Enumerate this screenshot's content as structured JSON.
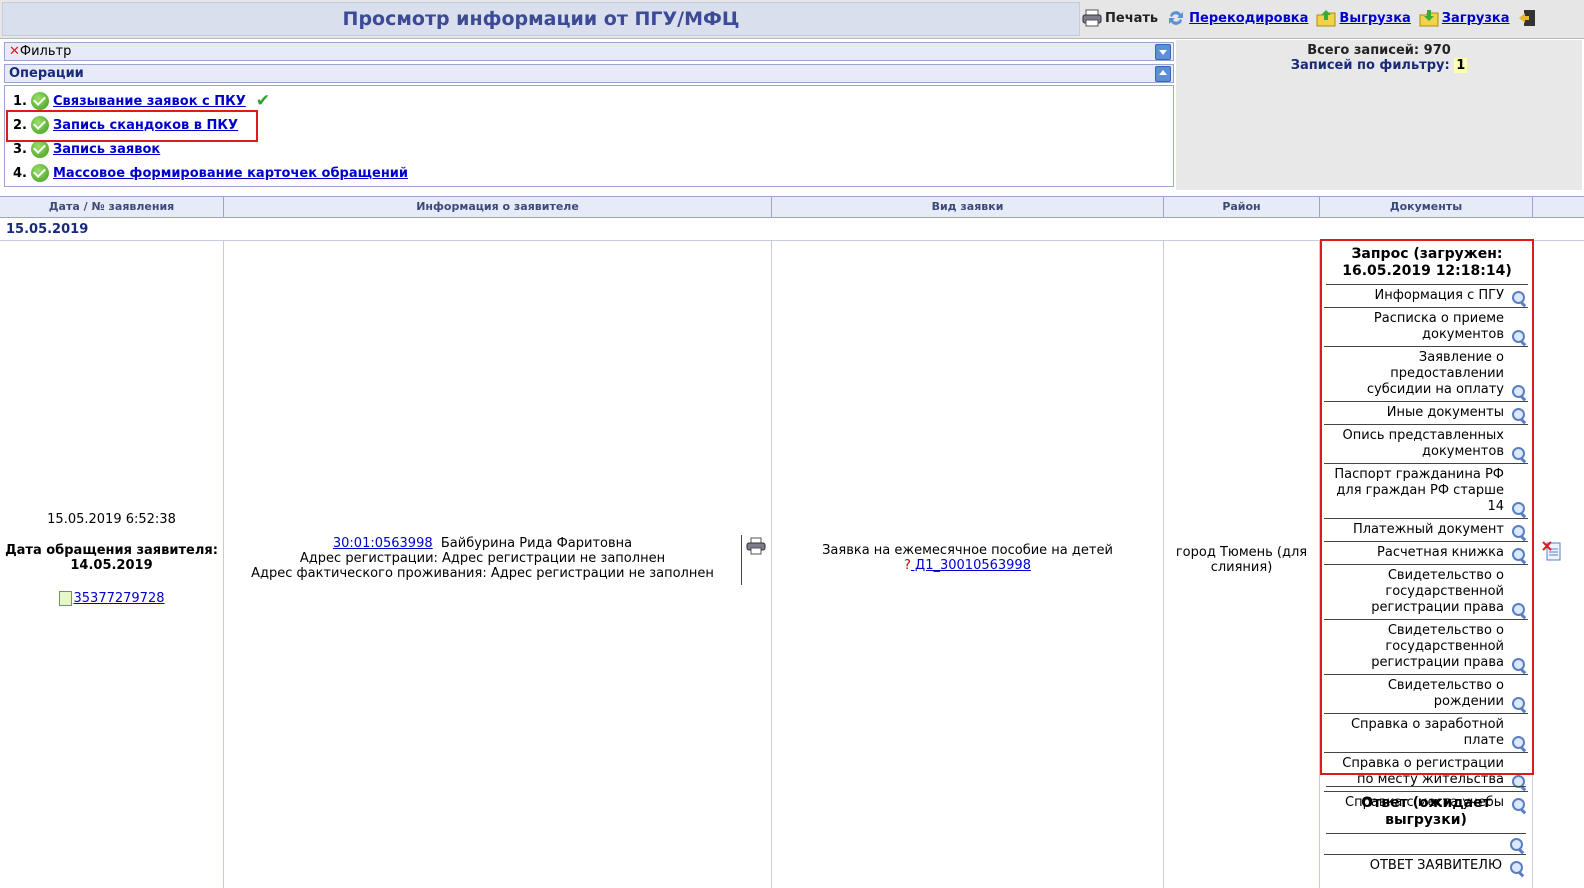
{
  "header": {
    "title": "Просмотр информации от ПГУ/МФЦ",
    "tools": [
      {
        "label": "Печать",
        "icon": "printer-icon"
      },
      {
        "label": "Перекодировка",
        "icon": "recode-icon"
      },
      {
        "label": "Выгрузка",
        "icon": "export-icon"
      },
      {
        "label": "Загрузка",
        "icon": "import-icon"
      }
    ]
  },
  "filter": {
    "label": "Фильтр"
  },
  "operations": {
    "title": "Операции",
    "items": [
      {
        "num": "1.",
        "label": "Связывание заявок с ПКУ"
      },
      {
        "num": "2.",
        "label": "Запись скандоков в ПКУ"
      },
      {
        "num": "3.",
        "label": "Запись заявок"
      },
      {
        "num": "4.",
        "label": "Массовое формирование карточек обращений"
      }
    ]
  },
  "stats": {
    "total_label": "Всего записей:",
    "total": "970",
    "filter_label": "Записей по фильтру:",
    "filter_count": "1"
  },
  "table": {
    "columns": [
      "Дата / № заявления",
      "Информация о заявителе",
      "Вид заявки",
      "Район",
      "Документы"
    ],
    "date_group": "15.05.2019",
    "row": {
      "datetime": "15.05.2019 6:52:38",
      "applied_label": "Дата обращения заявителя: 14.05.2019",
      "doc_number": "35377279728",
      "applicant_id": "30:01:0563998",
      "applicant_name": "Байбурина Рида Фаритовна",
      "reg_address": "Адрес регистрации: Адрес регистрации не заполнен",
      "actual_address": "Адрес фактического проживания: Адрес регистрации не заполнен",
      "request_type": "Заявка на ежемесячное пособие на детей",
      "request_q": "?",
      "request_link": " Д1_30010563998",
      "district": "город Тюмень (для слияния)",
      "documents": {
        "request_header": "Запрос (загружен: 16.05.2019 12:18:14)",
        "items": [
          "Информация с ПГУ",
          "Расписка о приеме документов",
          "Заявление о предоставлении субсидии на оплату",
          "Иные документы",
          "Опись представленных документов",
          "Паспорт гражданина РФ для граждан РФ старше 14",
          "Платежный документ",
          "Расчетная книжка",
          "Свидетельство о государственной регистрации права",
          "Свидетельство о государственной регистрации права",
          "Свидетельство о рождении",
          "Справка о заработной плате",
          "Справка о регистрации по месту жительства",
          "Справка с места учебы"
        ],
        "response_header": "Ответ (ожидает выгрузки)",
        "response_items": [
          "",
          "ОТВЕТ ЗАЯВИТЕЛЮ"
        ]
      }
    }
  }
}
